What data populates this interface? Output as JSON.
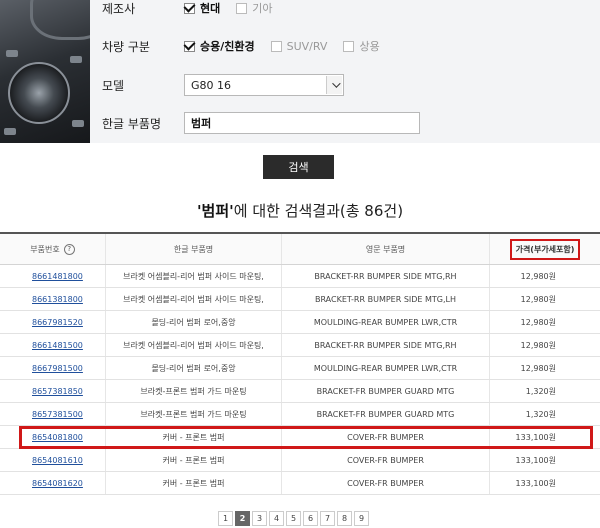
{
  "filters": {
    "manufacturer": {
      "label": "제조사",
      "options": [
        {
          "text": "현대",
          "checked": true
        },
        {
          "text": "기아",
          "checked": false
        }
      ]
    },
    "vehicle_type": {
      "label": "차량 구분",
      "options": [
        {
          "text": "승용/친환경",
          "checked": true
        },
        {
          "text": "SUV/RV",
          "checked": false
        },
        {
          "text": "상용",
          "checked": false
        }
      ]
    },
    "model": {
      "label": "모델",
      "value": "G80 16"
    },
    "part_name": {
      "label": "한글 부품명",
      "value": "범퍼"
    }
  },
  "search_button": "검색",
  "result": {
    "quote_open": "'",
    "keyword": "범퍼",
    "quote_close": "'",
    "suffix": "에 대한 검색결과(총 86건)"
  },
  "table": {
    "headers": {
      "part_no": "부품번호",
      "help_icon": "?",
      "kor_name": "한글 부품명",
      "eng_name": "영문 부품명",
      "price": "가격(부가세포함)"
    },
    "rows": [
      {
        "part_no": "8661481800",
        "kor": "브라켓 어셈블리-리어 범퍼 사이드 마운팅,",
        "eng": "BRACKET-RR BUMPER SIDE MTG,RH",
        "price": "12,980원"
      },
      {
        "part_no": "8661381800",
        "kor": "브라켓 어셈블리-리어 범퍼 사이드 마운팅,",
        "eng": "BRACKET-RR BUMPER SIDE MTG,LH",
        "price": "12,980원"
      },
      {
        "part_no": "8667981520",
        "kor": "몰딩-리어 범퍼 로어,중앙",
        "eng": "MOULDING-REAR BUMPER LWR,CTR",
        "price": "12,980원"
      },
      {
        "part_no": "8661481500",
        "kor": "브라켓 어셈블리-리어 범퍼 사이드 마운팅,",
        "eng": "BRACKET-RR BUMPER SIDE MTG,RH",
        "price": "12,980원"
      },
      {
        "part_no": "8667981500",
        "kor": "몰딩-리어 범퍼 로어,중앙",
        "eng": "MOULDING-REAR BUMPER LWR,CTR",
        "price": "12,980원"
      },
      {
        "part_no": "8657381850",
        "kor": "브라켓-프론트 범퍼 가드 마운팅",
        "eng": "BRACKET-FR BUMPER GUARD MTG",
        "price": "1,320원"
      },
      {
        "part_no": "8657381500",
        "kor": "브라켓-프론트 범퍼 가드 마운팅",
        "eng": "BRACKET-FR BUMPER GUARD MTG",
        "price": "1,320원"
      },
      {
        "part_no": "8654081800",
        "kor": "커버 - 프론트 범퍼",
        "eng": "COVER-FR BUMPER",
        "price": "133,100원"
      },
      {
        "part_no": "8654081610",
        "kor": "커버 - 프론트 범퍼",
        "eng": "COVER-FR BUMPER",
        "price": "133,100원"
      },
      {
        "part_no": "8654081620",
        "kor": "커버 - 프론트 범퍼",
        "eng": "COVER-FR BUMPER",
        "price": "133,100원"
      }
    ]
  },
  "pagination": {
    "pages": [
      "1",
      "2",
      "3",
      "4",
      "5",
      "6",
      "7",
      "8",
      "9"
    ],
    "current": "2"
  },
  "colors": {
    "highlight": "#d01818",
    "link": "#1f4f9c",
    "button": "#2b2b2b"
  }
}
